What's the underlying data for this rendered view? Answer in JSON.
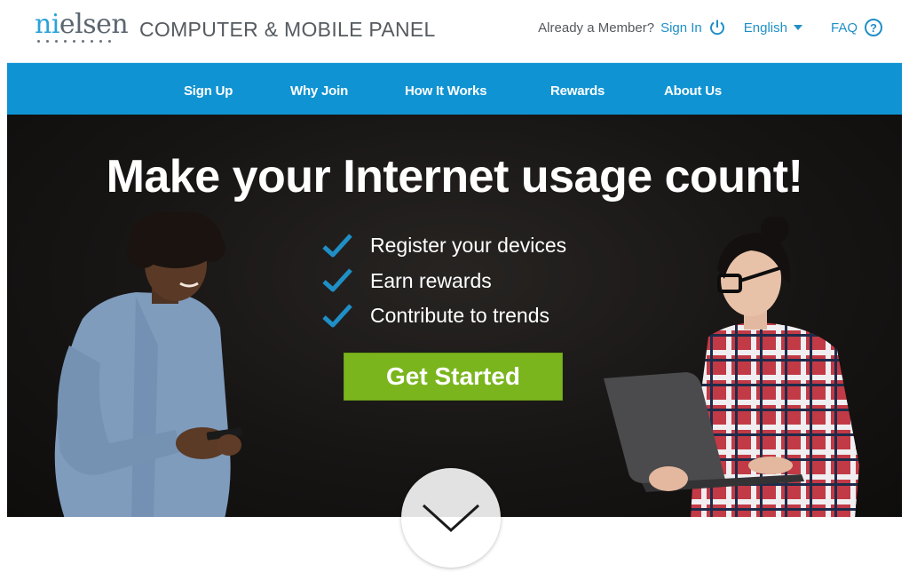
{
  "header": {
    "logo_prefix": "ni",
    "logo_rest": "elsen",
    "title": "COMPUTER & MOBILE PANEL",
    "member_question": "Already a Member?",
    "sign_in_label": "Sign In",
    "sign_in_icon": "power-icon",
    "language_label": "English",
    "language_icon": "caret-down-icon",
    "faq_label": "FAQ",
    "faq_icon": "help-circle-icon",
    "faq_icon_glyph": "?"
  },
  "nav": {
    "items": [
      {
        "label": "Sign Up"
      },
      {
        "label": "Why Join"
      },
      {
        "label": "How It Works"
      },
      {
        "label": "Rewards"
      },
      {
        "label": "About Us"
      }
    ],
    "background_color": "#0f93d2"
  },
  "hero": {
    "title": "Make your Internet usage count!",
    "benefits": [
      {
        "text": "Register your devices",
        "icon": "checkmark-icon"
      },
      {
        "text": "Earn rewards",
        "icon": "checkmark-icon"
      },
      {
        "text": "Contribute to trends",
        "icon": "checkmark-icon"
      }
    ],
    "cta_label": "Get Started",
    "cta_color": "#7ab51d",
    "check_color": "#1f8fc6",
    "left_image": "man-with-smartphone",
    "right_image": "woman-with-laptop",
    "scroll_icon": "chevron-down-icon"
  }
}
